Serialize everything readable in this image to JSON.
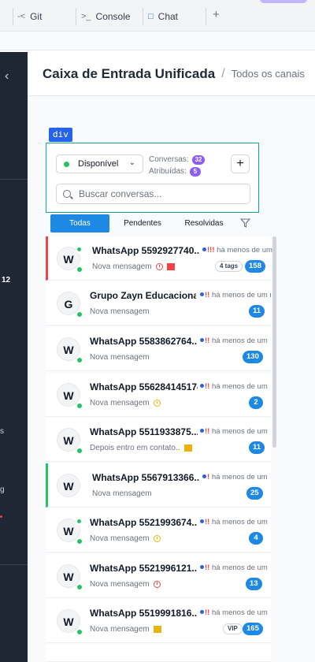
{
  "tabs": [
    {
      "icon": "git-icon",
      "label": "Git"
    },
    {
      "icon": "console-icon",
      "label": "Console"
    },
    {
      "icon": "chat-icon",
      "label": "Chat"
    }
  ],
  "tab_add": "+",
  "sidebar": {
    "badge": "12",
    "frag_a": "s",
    "frag_b": "g"
  },
  "header": {
    "title": "Caixa de Entrada Unificada",
    "separator": "/",
    "crumb": "Todos os canais"
  },
  "devtag": "div",
  "panel": {
    "status": "Disponível",
    "conversas_label": "Conversas:",
    "conversas_count": "32",
    "atribuidas_label": "Atribuídas:",
    "atribuidas_count": "5",
    "add_label": "+",
    "search_placeholder": "Buscar conversas..."
  },
  "filters": [
    "Todas",
    "Pendentes",
    "Resolvidas"
  ],
  "conversations": [
    {
      "initial": "W",
      "name": "WhatsApp 5592927740...",
      "meta": "há menos de um",
      "preview": "Nova mensagem",
      "tag": "4 tags",
      "count": "158"
    },
    {
      "initial": "G",
      "name": "Grupo Zayn Educacional",
      "meta": "há menos de um m",
      "preview": "Nova mensagem",
      "count": "11"
    },
    {
      "initial": "W",
      "name": "WhatsApp 5583862764...",
      "meta": "há menos de um",
      "preview": "Nova mensagem",
      "count": "130"
    },
    {
      "initial": "W",
      "name": "WhatsApp 556284145174",
      "meta": "há menos de um",
      "preview": "Nova mensagem",
      "count": "2"
    },
    {
      "initial": "W",
      "name": "WhatsApp 5511933875...",
      "meta": "há menos de um",
      "preview": "Depois entro em contato..",
      "count": "11"
    },
    {
      "initial": "W",
      "name": "WhatsApp 5567913366...",
      "meta": "há menos de um",
      "preview": "Nova mensagem",
      "count": "25"
    },
    {
      "initial": "W",
      "name": "WhatsApp 5521993674...",
      "meta": "há menos de um",
      "preview": "Nova mensagem",
      "count": "4"
    },
    {
      "initial": "W",
      "name": "WhatsApp 5521996121...",
      "meta": "há menos de um",
      "preview": "Nova mensagem",
      "count": "13"
    },
    {
      "initial": "W",
      "name": "WhatsApp 5519991816...",
      "meta": "há menos de um",
      "preview": "Nova mensagem",
      "tag": "VIP",
      "count": "165"
    }
  ],
  "colors": {
    "accent": "#1e88e5",
    "online": "#22c55e",
    "urgent": "#ef4444",
    "warning": "#eab308",
    "purple": "#8b5cf6"
  }
}
